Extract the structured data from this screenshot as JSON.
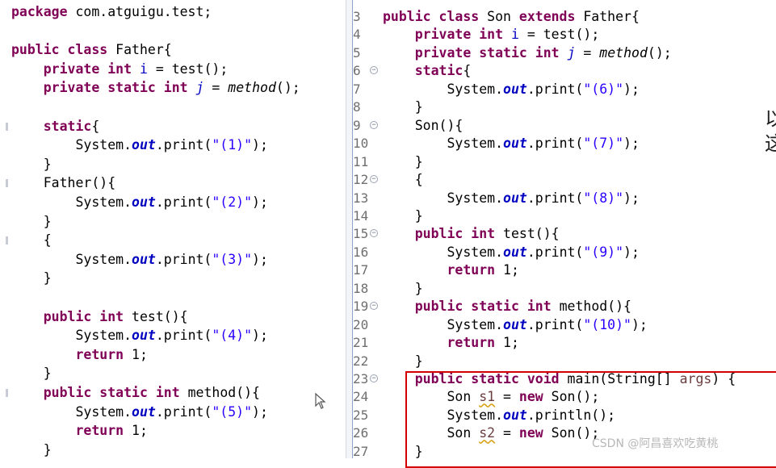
{
  "left_editor": {
    "lines": [
      [
        {
          "t": "package",
          "c": "kw"
        },
        {
          "t": " com.atguigu.test;",
          "c": "pl"
        }
      ],
      [],
      [
        {
          "t": "public",
          "c": "kw"
        },
        {
          "t": " ",
          "c": "pl"
        },
        {
          "t": "class",
          "c": "kw"
        },
        {
          "t": " Father{",
          "c": "pl"
        }
      ],
      [
        {
          "t": "    ",
          "c": "pl"
        },
        {
          "t": "private",
          "c": "kw"
        },
        {
          "t": " ",
          "c": "pl"
        },
        {
          "t": "int",
          "c": "kw"
        },
        {
          "t": " ",
          "c": "pl"
        },
        {
          "t": "i",
          "c": "fld"
        },
        {
          "t": " = test();",
          "c": "pl"
        }
      ],
      [
        {
          "t": "    ",
          "c": "pl"
        },
        {
          "t": "private",
          "c": "kw"
        },
        {
          "t": " ",
          "c": "pl"
        },
        {
          "t": "static",
          "c": "kw"
        },
        {
          "t": " ",
          "c": "pl"
        },
        {
          "t": "int",
          "c": "kw"
        },
        {
          "t": " ",
          "c": "pl"
        },
        {
          "t": "j",
          "c": "sfld"
        },
        {
          "t": " = ",
          "c": "pl"
        },
        {
          "t": "method",
          "c": "sm"
        },
        {
          "t": "();",
          "c": "pl"
        }
      ],
      [],
      [
        {
          "t": "    ",
          "c": "pl"
        },
        {
          "t": "static",
          "c": "kw"
        },
        {
          "t": "{",
          "c": "pl"
        }
      ],
      [
        {
          "t": "        System.",
          "c": "pl"
        },
        {
          "t": "out",
          "c": "out"
        },
        {
          "t": ".print(",
          "c": "pl"
        },
        {
          "t": "\"(1)\"",
          "c": "str"
        },
        {
          "t": ");",
          "c": "pl"
        }
      ],
      [
        {
          "t": "    }",
          "c": "pl"
        }
      ],
      [
        {
          "t": "    Father(){",
          "c": "pl"
        }
      ],
      [
        {
          "t": "        System.",
          "c": "pl"
        },
        {
          "t": "out",
          "c": "out"
        },
        {
          "t": ".print(",
          "c": "pl"
        },
        {
          "t": "\"(2)\"",
          "c": "str"
        },
        {
          "t": ");",
          "c": "pl"
        }
      ],
      [
        {
          "t": "    }",
          "c": "pl"
        }
      ],
      [
        {
          "t": "    {",
          "c": "pl"
        }
      ],
      [
        {
          "t": "        System.",
          "c": "pl"
        },
        {
          "t": "out",
          "c": "out"
        },
        {
          "t": ".print(",
          "c": "pl"
        },
        {
          "t": "\"(3)\"",
          "c": "str"
        },
        {
          "t": ");",
          "c": "pl"
        }
      ],
      [
        {
          "t": "    }",
          "c": "pl"
        }
      ],
      [],
      [
        {
          "t": "    ",
          "c": "pl"
        },
        {
          "t": "public",
          "c": "kw"
        },
        {
          "t": " ",
          "c": "pl"
        },
        {
          "t": "int",
          "c": "kw"
        },
        {
          "t": " test(){",
          "c": "pl"
        }
      ],
      [
        {
          "t": "        System.",
          "c": "pl"
        },
        {
          "t": "out",
          "c": "out"
        },
        {
          "t": ".print(",
          "c": "pl"
        },
        {
          "t": "\"(4)\"",
          "c": "str"
        },
        {
          "t": ");",
          "c": "pl"
        }
      ],
      [
        {
          "t": "        ",
          "c": "pl"
        },
        {
          "t": "return",
          "c": "kw"
        },
        {
          "t": " 1;",
          "c": "pl"
        }
      ],
      [
        {
          "t": "    }",
          "c": "pl"
        }
      ],
      [
        {
          "t": "    ",
          "c": "pl"
        },
        {
          "t": "public",
          "c": "kw"
        },
        {
          "t": " ",
          "c": "pl"
        },
        {
          "t": "static",
          "c": "kw"
        },
        {
          "t": " ",
          "c": "pl"
        },
        {
          "t": "int",
          "c": "kw"
        },
        {
          "t": " method(){",
          "c": "pl"
        }
      ],
      [
        {
          "t": "        System.",
          "c": "pl"
        },
        {
          "t": "out",
          "c": "out"
        },
        {
          "t": ".print(",
          "c": "pl"
        },
        {
          "t": "\"(5)\"",
          "c": "str"
        },
        {
          "t": ");",
          "c": "pl"
        }
      ],
      [
        {
          "t": "        ",
          "c": "pl"
        },
        {
          "t": "return",
          "c": "kw"
        },
        {
          "t": " 1;",
          "c": "pl"
        }
      ],
      [
        {
          "t": "    }",
          "c": "pl"
        }
      ]
    ]
  },
  "right_editor": {
    "lines": [
      {
        "n": "3",
        "fold": false,
        "tokens": [
          {
            "t": "public",
            "c": "kw"
          },
          {
            "t": " ",
            "c": "pl"
          },
          {
            "t": "class",
            "c": "kw"
          },
          {
            "t": " Son ",
            "c": "pl"
          },
          {
            "t": "extends",
            "c": "kw"
          },
          {
            "t": " Father{",
            "c": "pl"
          }
        ]
      },
      {
        "n": "4",
        "fold": false,
        "tokens": [
          {
            "t": "    ",
            "c": "pl"
          },
          {
            "t": "private",
            "c": "kw"
          },
          {
            "t": " ",
            "c": "pl"
          },
          {
            "t": "int",
            "c": "kw"
          },
          {
            "t": " ",
            "c": "pl"
          },
          {
            "t": "i",
            "c": "fld"
          },
          {
            "t": " = test();",
            "c": "pl"
          }
        ]
      },
      {
        "n": "5",
        "fold": false,
        "tokens": [
          {
            "t": "    ",
            "c": "pl"
          },
          {
            "t": "private",
            "c": "kw"
          },
          {
            "t": " ",
            "c": "pl"
          },
          {
            "t": "static",
            "c": "kw"
          },
          {
            "t": " ",
            "c": "pl"
          },
          {
            "t": "int",
            "c": "kw"
          },
          {
            "t": " ",
            "c": "pl"
          },
          {
            "t": "j",
            "c": "sfld"
          },
          {
            "t": " = ",
            "c": "pl"
          },
          {
            "t": "method",
            "c": "sm"
          },
          {
            "t": "();",
            "c": "pl"
          }
        ]
      },
      {
        "n": "6",
        "fold": true,
        "tokens": [
          {
            "t": "    ",
            "c": "pl"
          },
          {
            "t": "static",
            "c": "kw"
          },
          {
            "t": "{",
            "c": "pl"
          }
        ]
      },
      {
        "n": "7",
        "fold": false,
        "tokens": [
          {
            "t": "        System.",
            "c": "pl"
          },
          {
            "t": "out",
            "c": "out"
          },
          {
            "t": ".print(",
            "c": "pl"
          },
          {
            "t": "\"(6)\"",
            "c": "str"
          },
          {
            "t": ");",
            "c": "pl"
          }
        ]
      },
      {
        "n": "8",
        "fold": false,
        "tokens": [
          {
            "t": "    }",
            "c": "pl"
          }
        ]
      },
      {
        "n": "9",
        "fold": true,
        "tokens": [
          {
            "t": "    Son(){",
            "c": "pl"
          }
        ]
      },
      {
        "n": "10",
        "fold": false,
        "tokens": [
          {
            "t": "        System.",
            "c": "pl"
          },
          {
            "t": "out",
            "c": "out"
          },
          {
            "t": ".print(",
            "c": "pl"
          },
          {
            "t": "\"(7)\"",
            "c": "str"
          },
          {
            "t": ");",
            "c": "pl"
          }
        ]
      },
      {
        "n": "11",
        "fold": false,
        "tokens": [
          {
            "t": "    }",
            "c": "pl"
          }
        ]
      },
      {
        "n": "12",
        "fold": true,
        "tokens": [
          {
            "t": "    {",
            "c": "pl"
          }
        ]
      },
      {
        "n": "13",
        "fold": false,
        "tokens": [
          {
            "t": "        System.",
            "c": "pl"
          },
          {
            "t": "out",
            "c": "out"
          },
          {
            "t": ".print(",
            "c": "pl"
          },
          {
            "t": "\"(8)\"",
            "c": "str"
          },
          {
            "t": ");",
            "c": "pl"
          }
        ]
      },
      {
        "n": "14",
        "fold": false,
        "tokens": [
          {
            "t": "    }",
            "c": "pl"
          }
        ]
      },
      {
        "n": "15",
        "fold": true,
        "tokens": [
          {
            "t": "    ",
            "c": "pl"
          },
          {
            "t": "public",
            "c": "kw"
          },
          {
            "t": " ",
            "c": "pl"
          },
          {
            "t": "int",
            "c": "kw"
          },
          {
            "t": " test(){",
            "c": "pl"
          }
        ]
      },
      {
        "n": "16",
        "fold": false,
        "tokens": [
          {
            "t": "        System.",
            "c": "pl"
          },
          {
            "t": "out",
            "c": "out"
          },
          {
            "t": ".print(",
            "c": "pl"
          },
          {
            "t": "\"(9)\"",
            "c": "str"
          },
          {
            "t": ");",
            "c": "pl"
          }
        ]
      },
      {
        "n": "17",
        "fold": false,
        "tokens": [
          {
            "t": "        ",
            "c": "pl"
          },
          {
            "t": "return",
            "c": "kw"
          },
          {
            "t": " 1;",
            "c": "pl"
          }
        ]
      },
      {
        "n": "18",
        "fold": false,
        "tokens": [
          {
            "t": "    }",
            "c": "pl"
          }
        ]
      },
      {
        "n": "19",
        "fold": true,
        "tokens": [
          {
            "t": "    ",
            "c": "pl"
          },
          {
            "t": "public",
            "c": "kw"
          },
          {
            "t": " ",
            "c": "pl"
          },
          {
            "t": "static",
            "c": "kw"
          },
          {
            "t": " ",
            "c": "pl"
          },
          {
            "t": "int",
            "c": "kw"
          },
          {
            "t": " method(){",
            "c": "pl"
          }
        ]
      },
      {
        "n": "20",
        "fold": false,
        "tokens": [
          {
            "t": "        System.",
            "c": "pl"
          },
          {
            "t": "out",
            "c": "out"
          },
          {
            "t": ".print(",
            "c": "pl"
          },
          {
            "t": "\"(10)\"",
            "c": "str"
          },
          {
            "t": ");",
            "c": "pl"
          }
        ]
      },
      {
        "n": "21",
        "fold": false,
        "tokens": [
          {
            "t": "        ",
            "c": "pl"
          },
          {
            "t": "return",
            "c": "kw"
          },
          {
            "t": " 1;",
            "c": "pl"
          }
        ]
      },
      {
        "n": "22",
        "fold": false,
        "tokens": [
          {
            "t": "    }",
            "c": "pl"
          }
        ]
      },
      {
        "n": "23",
        "fold": true,
        "tokens": [
          {
            "t": "    ",
            "c": "pl"
          },
          {
            "t": "public",
            "c": "kw"
          },
          {
            "t": " ",
            "c": "pl"
          },
          {
            "t": "static",
            "c": "kw"
          },
          {
            "t": " ",
            "c": "pl"
          },
          {
            "t": "void",
            "c": "kw"
          },
          {
            "t": " main(String[] ",
            "c": "pl"
          },
          {
            "t": "args",
            "c": "var"
          },
          {
            "t": ") {",
            "c": "pl"
          }
        ]
      },
      {
        "n": "24",
        "fold": false,
        "tokens": [
          {
            "t": "        Son ",
            "c": "pl"
          },
          {
            "t": "s1",
            "c": "var warn"
          },
          {
            "t": " = ",
            "c": "pl"
          },
          {
            "t": "new",
            "c": "kw"
          },
          {
            "t": " Son();",
            "c": "pl"
          }
        ]
      },
      {
        "n": "25",
        "fold": false,
        "tokens": [
          {
            "t": "        System.",
            "c": "pl"
          },
          {
            "t": "out",
            "c": "out"
          },
          {
            "t": ".println();",
            "c": "pl"
          }
        ]
      },
      {
        "n": "26",
        "fold": false,
        "tokens": [
          {
            "t": "        Son ",
            "c": "pl"
          },
          {
            "t": "s2",
            "c": "var warn"
          },
          {
            "t": " = ",
            "c": "pl"
          },
          {
            "t": "new",
            "c": "kw"
          },
          {
            "t": " Son();",
            "c": "pl"
          }
        ]
      },
      {
        "n": "27",
        "fold": false,
        "tokens": [
          {
            "t": "    }",
            "c": "pl"
          }
        ]
      }
    ]
  },
  "side_text": {
    "line1": "以",
    "line2": "这"
  },
  "watermark": "CSDN @阿昌喜欢吃黄桃",
  "colors": {
    "keyword": "#7f0055",
    "field": "#0000c0",
    "string": "#2a00ff",
    "highlight_box": "#d40000"
  }
}
